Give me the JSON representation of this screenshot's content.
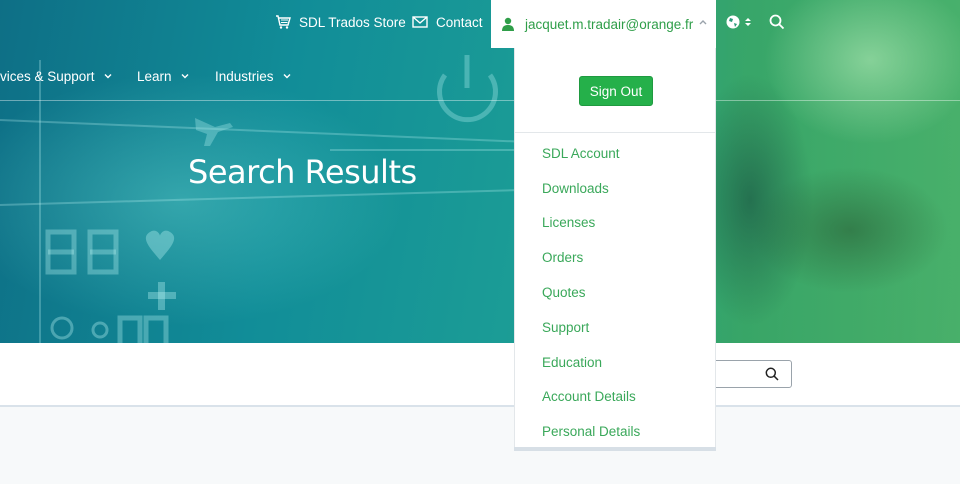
{
  "colors": {
    "brand_green": "#25b04a",
    "link_green": "#3aa85a",
    "hero_teal": "#118d98"
  },
  "utility": {
    "store": {
      "label": "SDL Trados Store",
      "icon": "cart-icon"
    },
    "contact": {
      "label": "Contact",
      "icon": "mail-icon"
    },
    "user": {
      "email": "jacquet.m.tradair@orange.fr",
      "icon": "user-icon",
      "caret": "chevron-up-icon"
    },
    "language_icon": "globe-icon",
    "search_icon": "search-icon"
  },
  "nav": {
    "items": [
      {
        "label": "vices & Support"
      },
      {
        "label": "Learn"
      },
      {
        "label": "Industries"
      }
    ]
  },
  "hero": {
    "title": "Search Results"
  },
  "search": {
    "placeholder": "",
    "value": ""
  },
  "account_menu": {
    "sign_out": "Sign Out",
    "items": [
      "SDL Account",
      "Downloads",
      "Licenses",
      "Orders",
      "Quotes",
      "Support",
      "Education",
      "Account Details",
      "Personal Details"
    ]
  }
}
